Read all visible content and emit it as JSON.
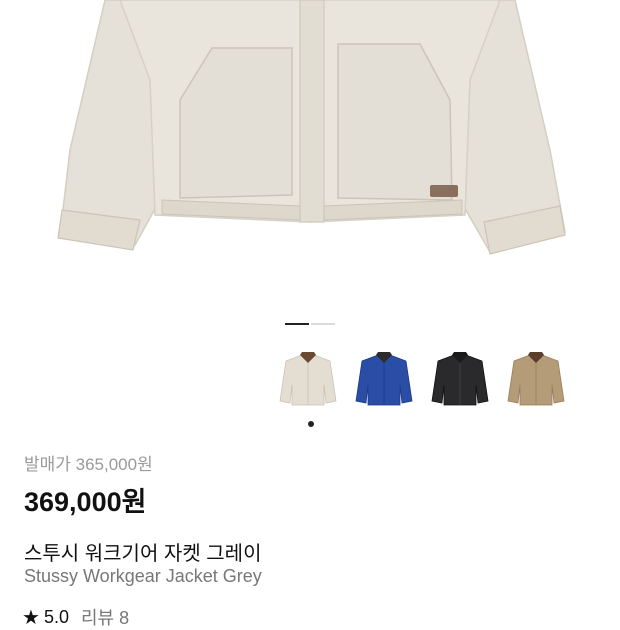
{
  "product": {
    "release_price_text": "발매가 365,000원",
    "price_text": "369,000원",
    "name_ko": "스투시 워크기어 자켓 그레이",
    "name_en": "Stussy Workgear Jacket Grey"
  },
  "gallery": {
    "pager_total": 2,
    "pager_active": 1,
    "thumbnails": [
      {
        "name": "grey",
        "body_color": "#e3ddd2",
        "collar_color": "#6a4a32"
      },
      {
        "name": "blue",
        "body_color": "#2a4da6",
        "collar_color": "#2b2b2b"
      },
      {
        "name": "black",
        "body_color": "#2a2a2c",
        "collar_color": "#1a1a1a"
      },
      {
        "name": "tan",
        "body_color": "#b59c78",
        "collar_color": "#5a3e2b"
      }
    ],
    "selected_thumbnail": 0
  },
  "rating": {
    "star_icon": "star-icon",
    "score": "5.0",
    "review_text": "리뷰 8"
  }
}
